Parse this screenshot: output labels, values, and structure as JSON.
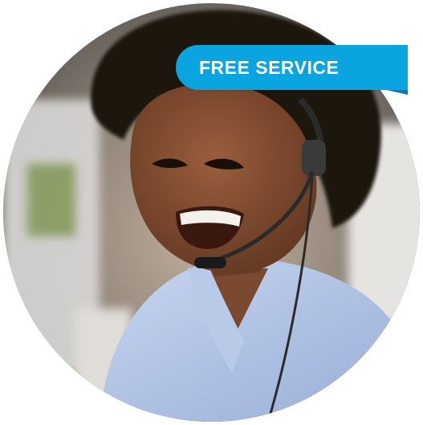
{
  "badge": {
    "text": "FREE SERVICE",
    "color": "#0aa5e1",
    "fold_color": "#067ab0"
  },
  "photo": {
    "subject": "smiling-agent-with-headset"
  }
}
